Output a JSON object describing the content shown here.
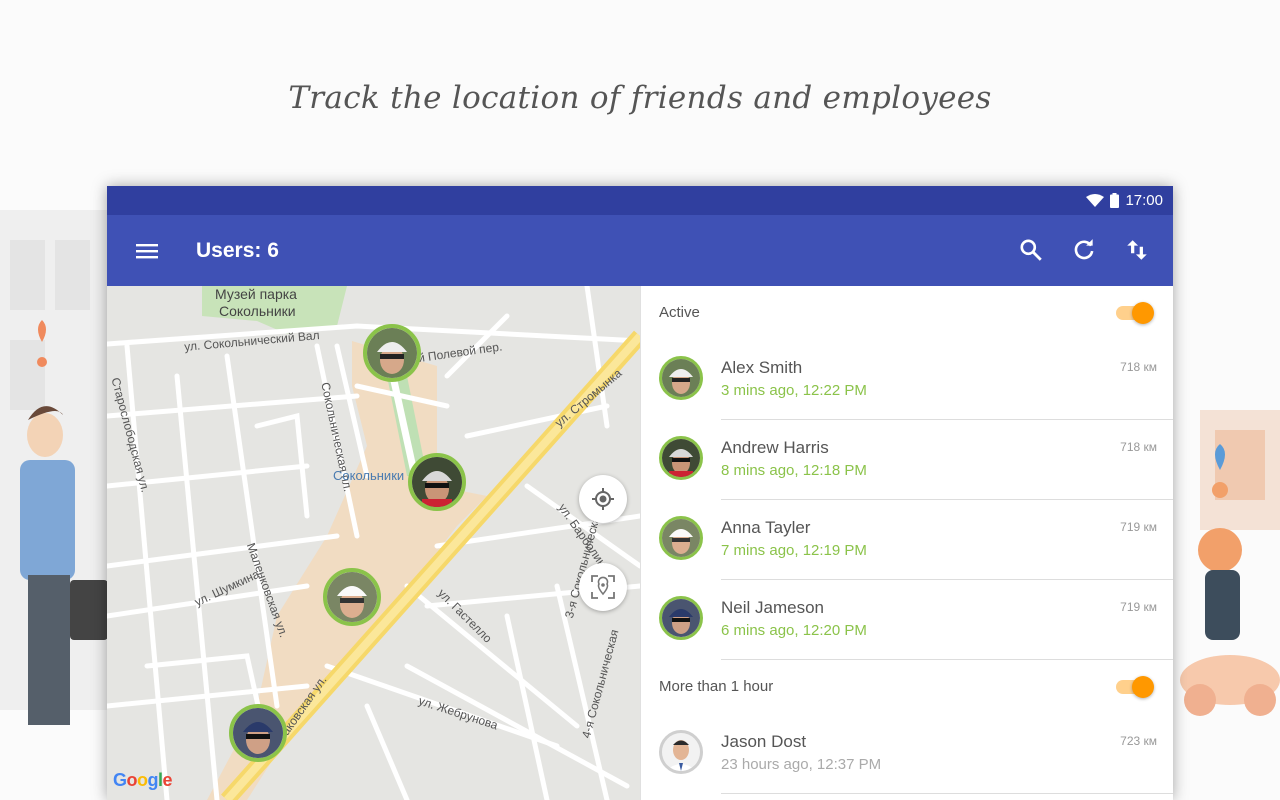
{
  "tagline": "Track the location of friends and employees",
  "status_bar": {
    "time": "17:00",
    "icons": [
      "wifi-icon",
      "battery-icon"
    ]
  },
  "app_bar": {
    "title": "Users: 6",
    "icons": [
      "menu-icon",
      "search-icon",
      "refresh-icon",
      "sort-icon"
    ]
  },
  "map": {
    "labels": {
      "museum_line1": "Музей парка",
      "museum_line2": "Сокольники",
      "sokolnichesky_val": "ул. Сокольнический Вал",
      "polevoy": "1-й Полевой пер.",
      "sokolnicheskaya_pl": "Сокольническая пл.",
      "stromynka": "ул. Стромынка",
      "starosloboda": "Старослободская ул.",
      "sokolniki": "Сокольники",
      "barbolina": "ул. Барболина",
      "shumkina": "ул. Шумкина",
      "malenkovskaya": "Маленковская ул.",
      "gastello": "ул. Гастелло",
      "sokolnicheskaya3": "3-я Сокольническая",
      "sokolnicheskaya4": "4-я Сокольническая",
      "rusakovskaya": "Русаковская ул.",
      "zhebrunova": "ул. Жебрунова"
    },
    "google": {
      "g1": "G",
      "o1": "o",
      "o2": "o",
      "g2": "g",
      "l": "l",
      "e": "e"
    },
    "accent": "#8bc34a"
  },
  "list": {
    "sections": [
      {
        "label": "Active",
        "toggle_on": true,
        "users": [
          {
            "name": "Alex Smith",
            "time": "3 mins ago, 12:22 PM",
            "distance": "718 км"
          },
          {
            "name": "Andrew Harris",
            "time": "8 mins ago, 12:18 PM",
            "distance": "718 км"
          },
          {
            "name": "Anna Tayler",
            "time": "7 mins ago, 12:19 PM",
            "distance": "719 км"
          },
          {
            "name": "Neil Jameson",
            "time": "6 mins ago, 12:20 PM",
            "distance": "719 км"
          }
        ]
      },
      {
        "label": "More than 1 hour",
        "toggle_on": true,
        "users": [
          {
            "name": "Jason Dost",
            "time": "23 hours ago, 12:37 PM",
            "distance": "723 км"
          }
        ]
      }
    ]
  },
  "colors": {
    "primary": "#3f51b5",
    "primary_dark": "#303f9f",
    "active_green": "#8bc34a",
    "toggle_orange": "#ff9800"
  }
}
